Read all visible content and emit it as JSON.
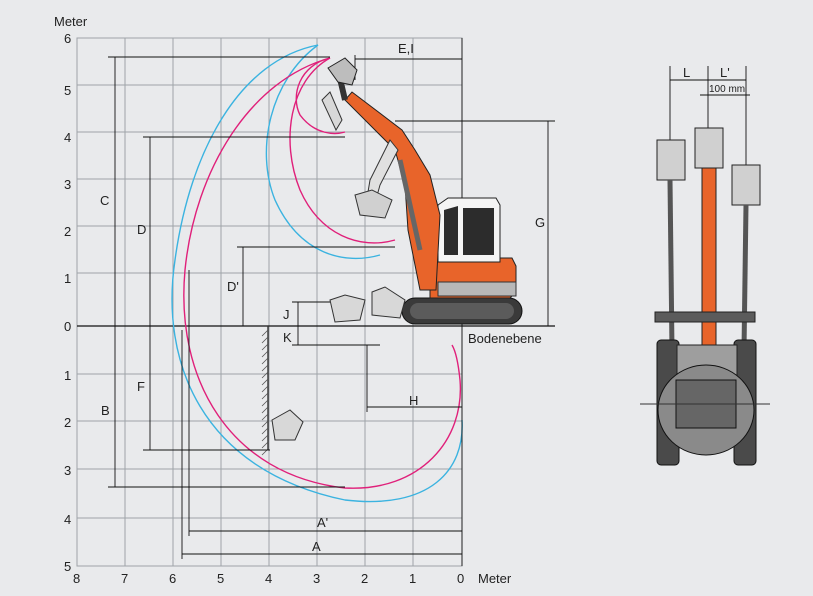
{
  "axes": {
    "y_unit": "Meter",
    "x_unit": "Meter",
    "y_ticks_above": [
      "6",
      "5",
      "4",
      "3",
      "2",
      "1",
      "0"
    ],
    "y_ticks_below": [
      "1",
      "2",
      "3",
      "4",
      "5"
    ],
    "x_ticks": [
      "8",
      "7",
      "6",
      "5",
      "4",
      "3",
      "2",
      "1",
      "0"
    ]
  },
  "ground_label": "Bodenebene",
  "dimension_labels": {
    "A": "A",
    "A_prime": "A'",
    "B": "B",
    "C": "C",
    "D": "D",
    "D_prime": "D'",
    "E_I": "E,I",
    "F": "F",
    "G": "G",
    "H": "H",
    "J": "J",
    "K": "K"
  },
  "front_view": {
    "L": "L",
    "L_prime": "L'",
    "offset": "100 mm"
  },
  "colors": {
    "background": "#e9eaec",
    "grid": "#9ea3a8",
    "reach_curve_blue": "#3bb3e0",
    "reach_curve_magenta": "#e0207a",
    "boom_orange": "#e8642a",
    "machine_dark": "#3a3a3a"
  }
}
